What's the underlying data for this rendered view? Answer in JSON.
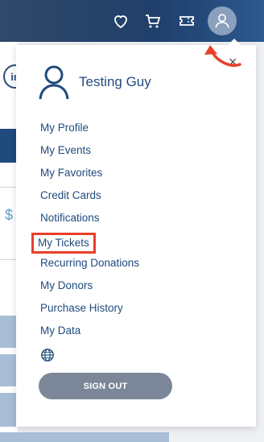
{
  "header": {
    "icons": [
      "heart-icon",
      "cart-icon",
      "ticket-icon",
      "user-icon"
    ]
  },
  "background": {
    "badge_text": "in",
    "price_fragment": "$"
  },
  "dropdown": {
    "user_name": "Testing Guy",
    "close_label": "×",
    "menu_items": [
      {
        "label": "My Profile"
      },
      {
        "label": "My Events"
      },
      {
        "label": "My Favorites"
      },
      {
        "label": "Credit Cards"
      },
      {
        "label": "Notifications"
      },
      {
        "label": "My Tickets",
        "highlighted": true
      },
      {
        "label": "Recurring Donations"
      },
      {
        "label": "My Donors"
      },
      {
        "label": "Purchase History"
      },
      {
        "label": "My Data"
      }
    ],
    "language_icon": "globe-icon",
    "sign_out_label": "SIGN OUT"
  },
  "colors": {
    "header": "#1f3f6b",
    "link": "#1f4a7e",
    "highlight": "#e8402a",
    "sign_out_button": "#7b8799"
  }
}
